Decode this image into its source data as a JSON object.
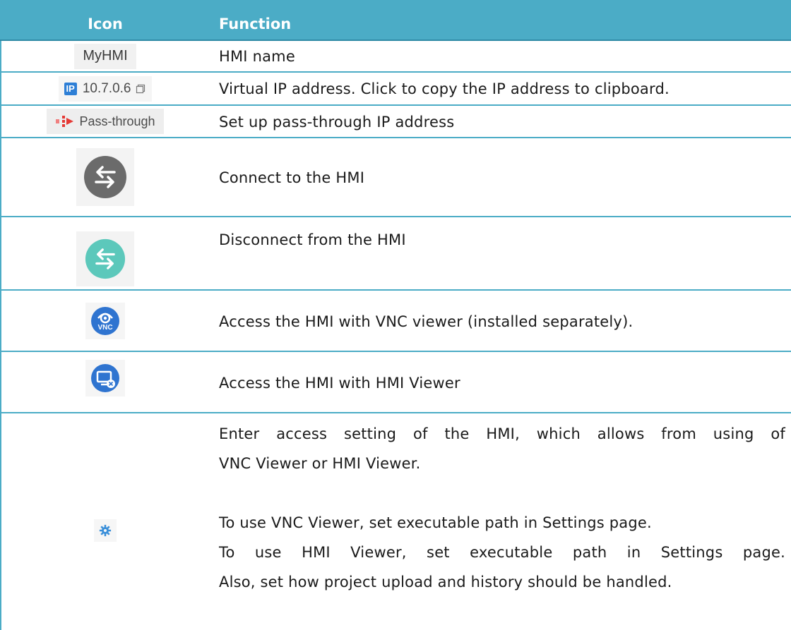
{
  "header": {
    "col_icon": "Icon",
    "col_function": "Function"
  },
  "rows": [
    {
      "icon_text": "MyHMI",
      "function": "HMI name"
    },
    {
      "icon_badge": "IP",
      "icon_text": "10.7.0.6",
      "function": "Virtual IP address. Click to copy the IP address to clipboard."
    },
    {
      "icon_text": "Pass-through",
      "function": "Set up pass-through IP address"
    },
    {
      "icon": "connect-icon",
      "function": "Connect to the HMI"
    },
    {
      "icon": "disconnect-icon",
      "function": "Disconnect from the HMI"
    },
    {
      "icon": "vnc-icon",
      "icon_text": "VNC",
      "function": "Access the HMI with VNC viewer (installed separately)."
    },
    {
      "icon": "hmi-viewer-icon",
      "function": "Access the HMI with HMI Viewer"
    },
    {
      "icon": "gear-icon",
      "function_lines": [
        "Enter access setting of the HMI, which allows from using of",
        "VNC Viewer or HMI Viewer.",
        "",
        "To use VNC Viewer, set executable path in Settings page.",
        "To use HMI Viewer, set executable path in Settings page.",
        "Also, set how project upload and history should be handled."
      ]
    }
  ],
  "colors": {
    "header_bg": "#4bacc6",
    "grid": "#4bacc6",
    "connect_gray": "#6b6b6b",
    "disconnect_teal": "#5cc8bb",
    "blue": "#2f74d0"
  }
}
